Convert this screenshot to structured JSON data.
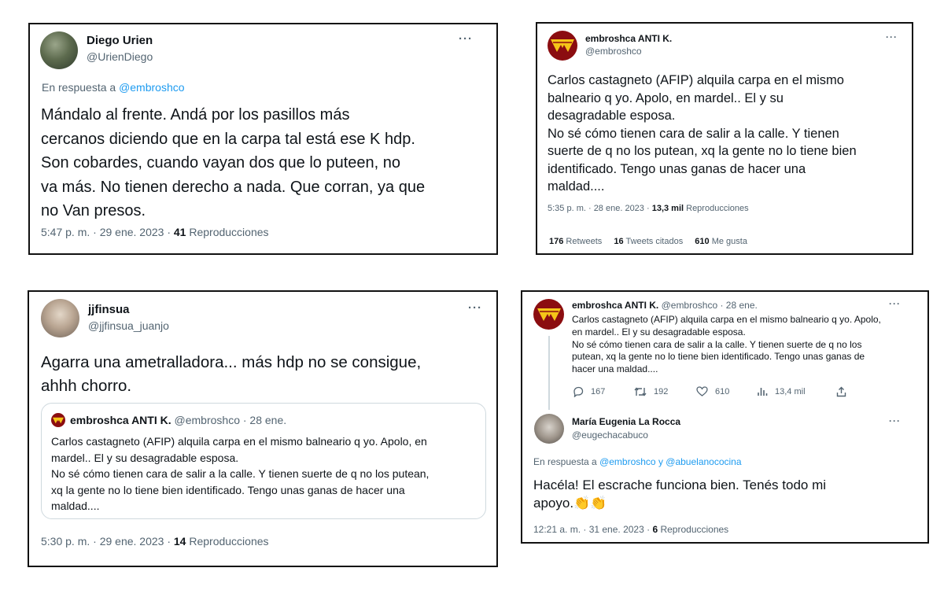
{
  "tweet1": {
    "name": "Diego Urien",
    "handle": "@UrienDiego",
    "reply_prefix": "En respuesta a ",
    "reply_to": "@embroshco",
    "text": "Mándalo al frente. Andá por los pasillos más\ncercanos diciendo que en la carpa tal está ese K hdp.\nSon cobardes,  cuando vayan dos que lo puteen, no\nva más. No tienen derecho a nada. Que corran, ya que\nno Van presos.",
    "timestamp": "5:47 p. m. · 29 ene. 2023 · ",
    "views_count": "41",
    "views_label": " Reproducciones",
    "more": "···"
  },
  "tweet2": {
    "name": "embroshca ANTI K.",
    "handle": "@embroshco",
    "text": "Carlos castagneto (AFIP) alquila carpa en el mismo\nbalneario q yo. Apolo, en mardel.. El y su\ndesagradable esposa.\n No sé cómo tienen cara de salir a la calle. Y tienen\nsuerte de q no los putean, xq la gente no lo tiene bien\nidentificado. Tengo unas ganas de hacer una\nmaldad....",
    "timestamp": "5:35 p. m. · 28 ene. 2023 · ",
    "views_count": "13,3 mil",
    "views_label": " Reproducciones",
    "retweets_count": "176",
    "retweets_label": " Retweets",
    "quotes_count": "16",
    "quotes_label": " Tweets citados",
    "likes_count": "610",
    "likes_label": " Me gusta",
    "more": "···"
  },
  "tweet3": {
    "name": "jjfinsua",
    "handle": "@jjfinsua_juanjo",
    "text": "Agarra una ametralladora... más hdp no se consigue,\nahhh chorro.",
    "quoted": {
      "name": "embroshca ANTI K.",
      "meta": " @embroshco · 28 ene.",
      "text": "Carlos castagneto (AFIP) alquila carpa en el mismo balneario q yo. Apolo, en\nmardel.. El y su desagradable esposa.\n No sé cómo tienen cara de salir a la calle. Y tienen suerte de q no los putean,\nxq la gente no lo tiene bien identificado. Tengo unas ganas de hacer una\nmaldad...."
    },
    "timestamp": "5:30 p. m. · 29 ene. 2023 · ",
    "views_count": "14",
    "views_label": " Reproducciones",
    "more": "···"
  },
  "tweet4": {
    "parent": {
      "name": "embroshca ANTI K.",
      "meta": " @embroshco · 28 ene.",
      "text": "Carlos castagneto (AFIP) alquila carpa en el mismo balneario q yo. Apolo,\nen mardel.. El y su desagradable esposa.\n No sé cómo tienen cara de salir a la calle. Y tienen suerte de q no los\nputean, xq la gente no lo tiene bien identificado. Tengo unas ganas de\nhacer una maldad....",
      "replies": "167",
      "retweets": "192",
      "likes": "610",
      "views": "13,4 mil"
    },
    "reply": {
      "name": "María Eugenia La Rocca",
      "handle": "@eugechacabuco",
      "reply_prefix": "En respuesta a ",
      "reply_to": "@embroshco y @abuelanococina",
      "text": "Hacéla! El escrache funciona bien. Tenés todo mi\napoyo.",
      "emoji": "👏👏",
      "timestamp": "12:21 a. m. · 31 ene. 2023 · ",
      "views_count": "6",
      "views_label": " Reproducciones"
    },
    "more": "···"
  },
  "icons": [
    "reply-icon",
    "retweet-icon",
    "like-icon",
    "views-icon",
    "share-icon",
    "wonder-woman-logo"
  ],
  "colors": {
    "link": "#1d9bf0",
    "secondary": "#536471",
    "primary_text": "#0f1419",
    "logo_red": "#8b0d10",
    "logo_gold": "#f5c518"
  }
}
